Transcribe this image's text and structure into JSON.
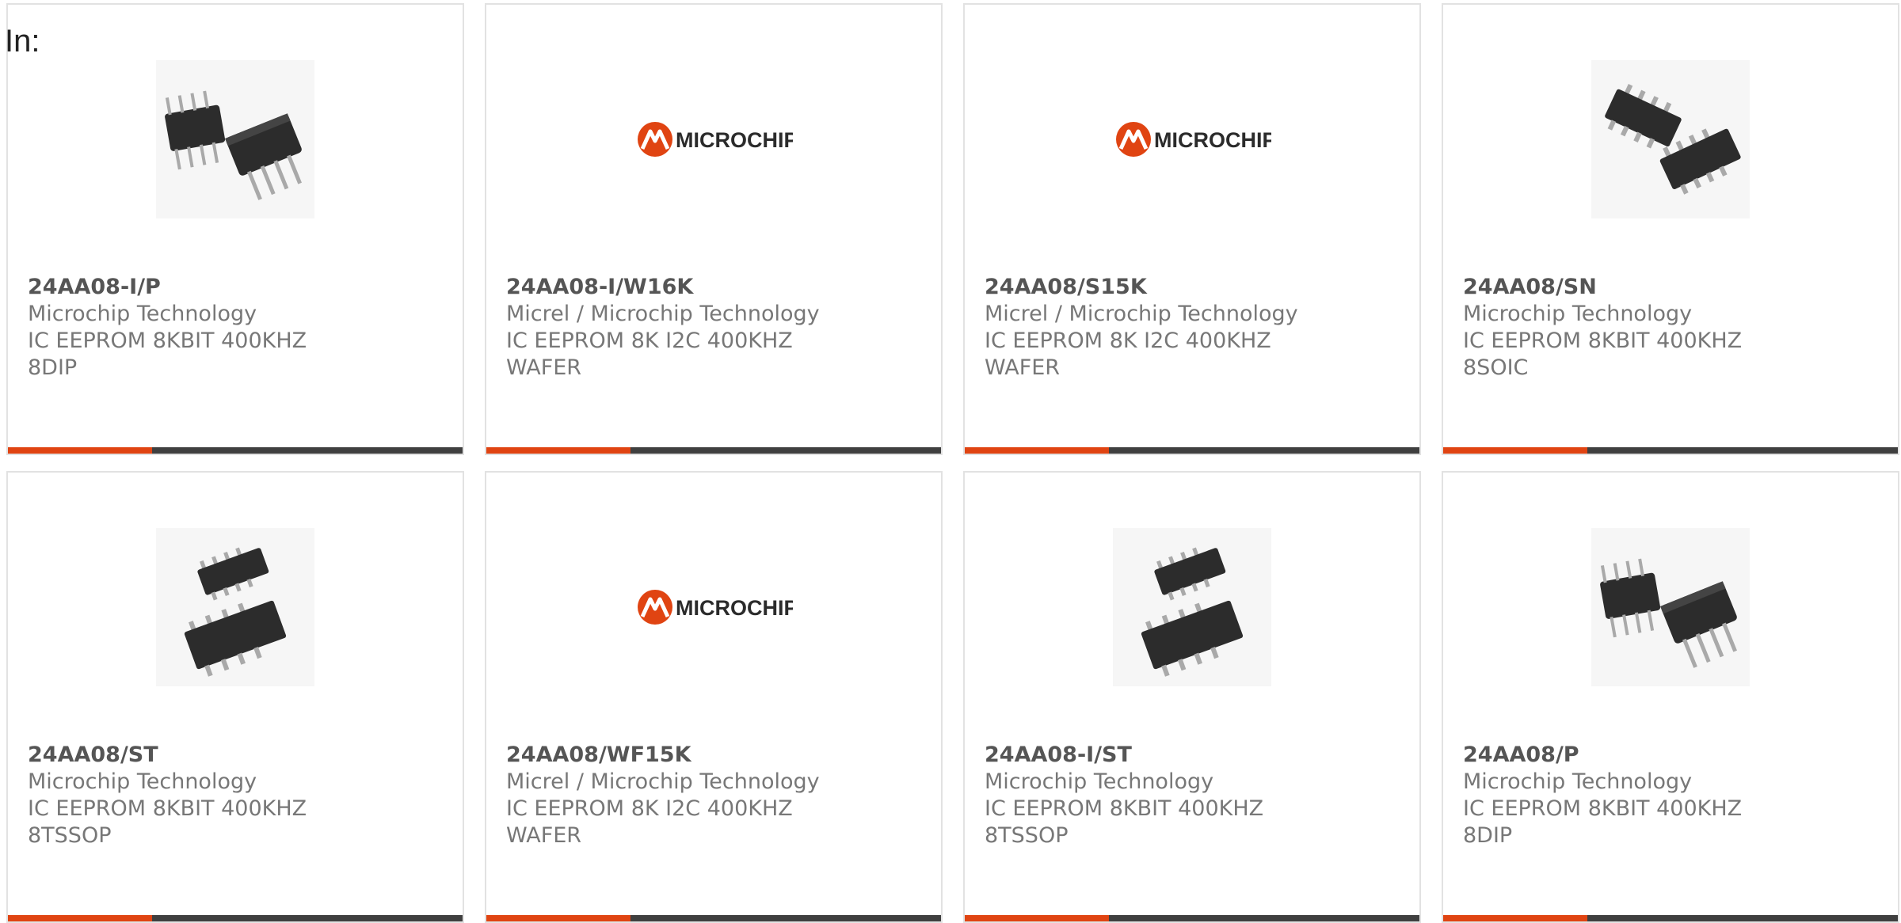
{
  "filter_label": "In:",
  "colors": {
    "accent": "#e04412",
    "bar": "#3f3f3f",
    "card_border": "#e2e2e2",
    "text": "#777777",
    "part_number": "#555555"
  },
  "logo_text": "MICROCHIP",
  "products": [
    {
      "part_number": "24AA08-I/P",
      "manufacturer": "Microchip Technology",
      "description": "IC EEPROM 8KBIT 400KHZ 8DIP",
      "image": "dip8-chips-icon"
    },
    {
      "part_number": "24AA08-I/W16K",
      "manufacturer": "Micrel / Microchip Technology",
      "description": "IC EEPROM 8K I2C 400KHZ WAFER",
      "image": "microchip-logo"
    },
    {
      "part_number": "24AA08/S15K",
      "manufacturer": "Micrel / Microchip Technology",
      "description": "IC EEPROM 8K I2C 400KHZ WAFER",
      "image": "microchip-logo"
    },
    {
      "part_number": "24AA08/SN",
      "manufacturer": "Microchip Technology",
      "description": "IC EEPROM 8KBIT 400KHZ 8SOIC",
      "image": "soic8-chips-icon"
    },
    {
      "part_number": "24AA08/ST",
      "manufacturer": "Microchip Technology",
      "description": "IC EEPROM 8KBIT 400KHZ 8TSSOP",
      "image": "tssop8-chips-icon"
    },
    {
      "part_number": "24AA08/WF15K",
      "manufacturer": "Micrel / Microchip Technology",
      "description": "IC EEPROM 8K I2C 400KHZ WAFER",
      "image": "microchip-logo"
    },
    {
      "part_number": "24AA08-I/ST",
      "manufacturer": "Microchip Technology",
      "description": "IC EEPROM 8KBIT 400KHZ 8TSSOP",
      "image": "tssop8-chips-icon"
    },
    {
      "part_number": "24AA08/P",
      "manufacturer": "Microchip Technology",
      "description": "IC EEPROM 8KBIT 400KHZ 8DIP",
      "image": "dip8-chips-icon"
    }
  ]
}
